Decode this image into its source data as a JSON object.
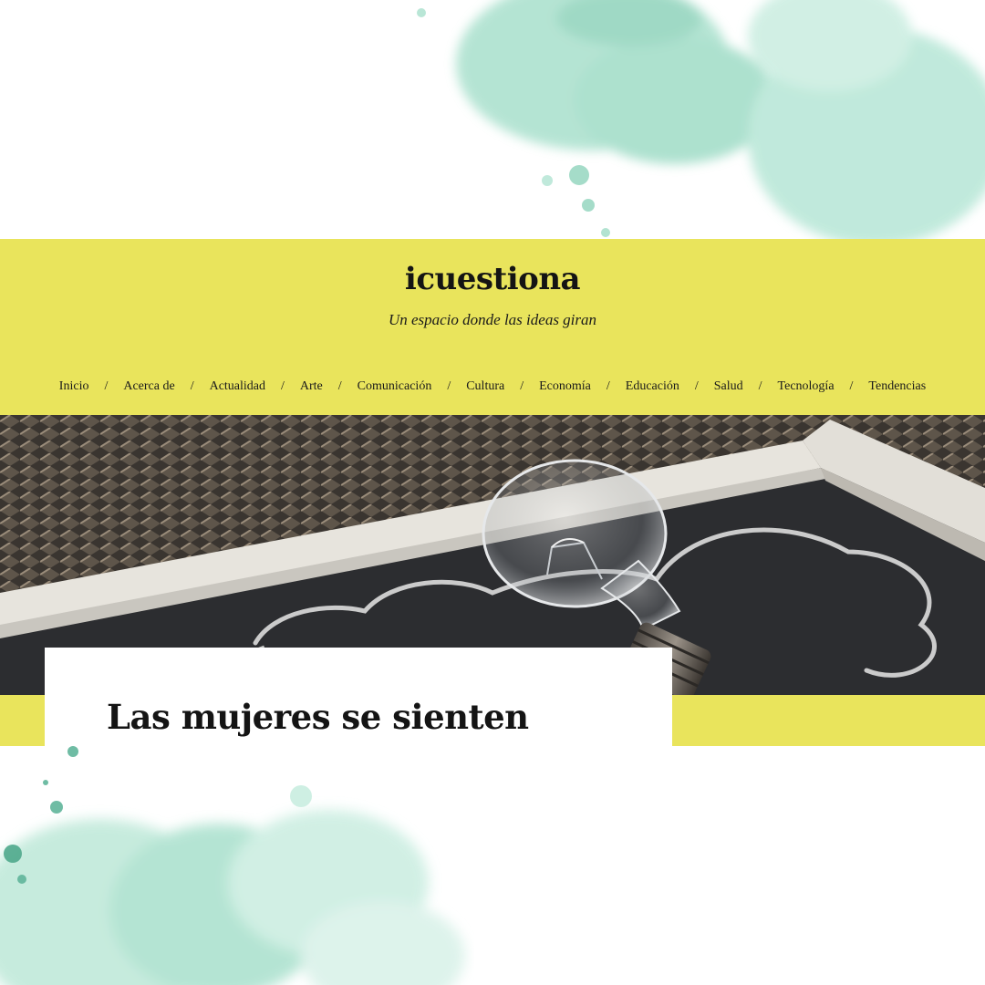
{
  "site": {
    "title": "icuestiona",
    "tagline": "Un espacio donde las ideas giran"
  },
  "nav": {
    "separator": "/",
    "items": [
      "Inicio",
      "Acerca de",
      "Actualidad",
      "Arte",
      "Comunicación",
      "Cultura",
      "Economía",
      "Educación",
      "Salud",
      "Tecnología",
      "Tendencias"
    ]
  },
  "post": {
    "title": "Las mujeres se sienten"
  },
  "colors": {
    "header_bg": "#e9e45c",
    "text": "#141414",
    "watercolor": "#9ad9c4"
  },
  "hero_image": "lightbulb-on-chalkboard"
}
